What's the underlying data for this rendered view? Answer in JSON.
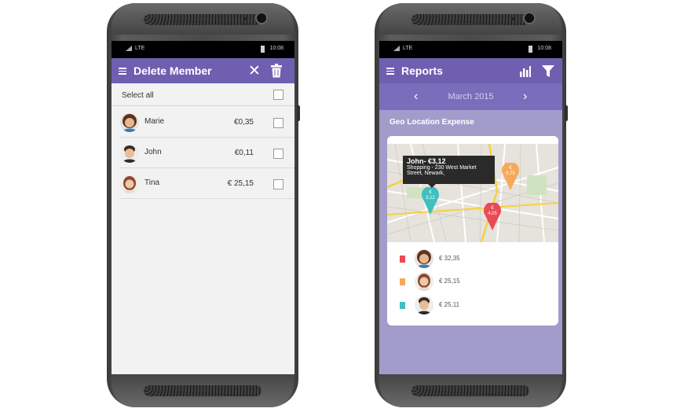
{
  "left_phone": {
    "status": {
      "network": "LTE",
      "time": "10:08"
    },
    "appbar": {
      "title": "Delete Member"
    },
    "select_all": {
      "label": "Select all"
    },
    "members": [
      {
        "name": "Marie",
        "amount": "€0,35"
      },
      {
        "name": "John",
        "amount": "€0,11"
      },
      {
        "name": "Tina",
        "amount": "€ 25,15"
      }
    ]
  },
  "right_phone": {
    "status": {
      "network": "LTE",
      "time": "10:08"
    },
    "appbar": {
      "title": "Reports"
    },
    "month": "March  2015",
    "section_title": "Geo Location Expense",
    "tooltip": {
      "title": "John- €3,12",
      "line1": "Shopping - 230 West Market",
      "line2": "Street, Newark,"
    },
    "markers": [
      {
        "label": "€\n3,12",
        "color": "#3fbfbf"
      },
      {
        "label": "€\n9,75",
        "color": "#f6a95a"
      },
      {
        "label": "€\n4,05",
        "color": "#ea4a55"
      }
    ],
    "legend": [
      {
        "color": "#ea4a55",
        "amount": "€ 32,35"
      },
      {
        "color": "#f6a95a",
        "amount": "€ 25,15"
      },
      {
        "color": "#3fbfbf",
        "amount": "€ 25,11"
      }
    ]
  }
}
